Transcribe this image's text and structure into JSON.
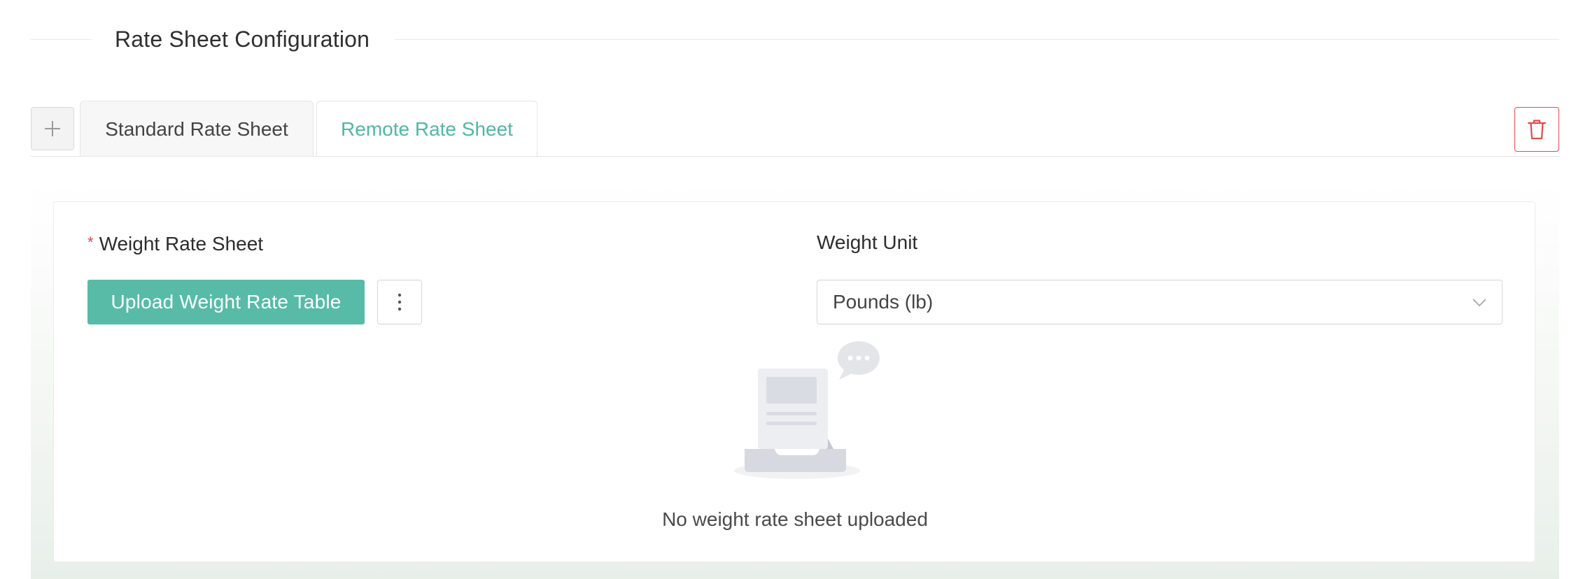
{
  "section": {
    "title": "Rate Sheet Configuration"
  },
  "tabs": {
    "add_icon": "plus-icon",
    "items": [
      {
        "label": "Standard Rate Sheet",
        "active": false
      },
      {
        "label": "Remote Rate Sheet",
        "active": true
      }
    ],
    "delete_icon": "trash-icon"
  },
  "form": {
    "weight_sheet": {
      "required_mark": "*",
      "label": "Weight Rate Sheet",
      "upload_label": "Upload Weight Rate Table",
      "more_icon": "vertical-ellipsis-icon"
    },
    "weight_unit": {
      "label": "Weight Unit",
      "selected": "Pounds (lb)",
      "chevron_icon": "chevron-down-icon"
    },
    "empty_state": {
      "icon": "empty-inbox-icon",
      "message": "No weight rate sheet uploaded"
    }
  },
  "colors": {
    "accent": "#57bba7",
    "active_tab_text": "#4fb8a3",
    "danger": "#e14b4b"
  }
}
